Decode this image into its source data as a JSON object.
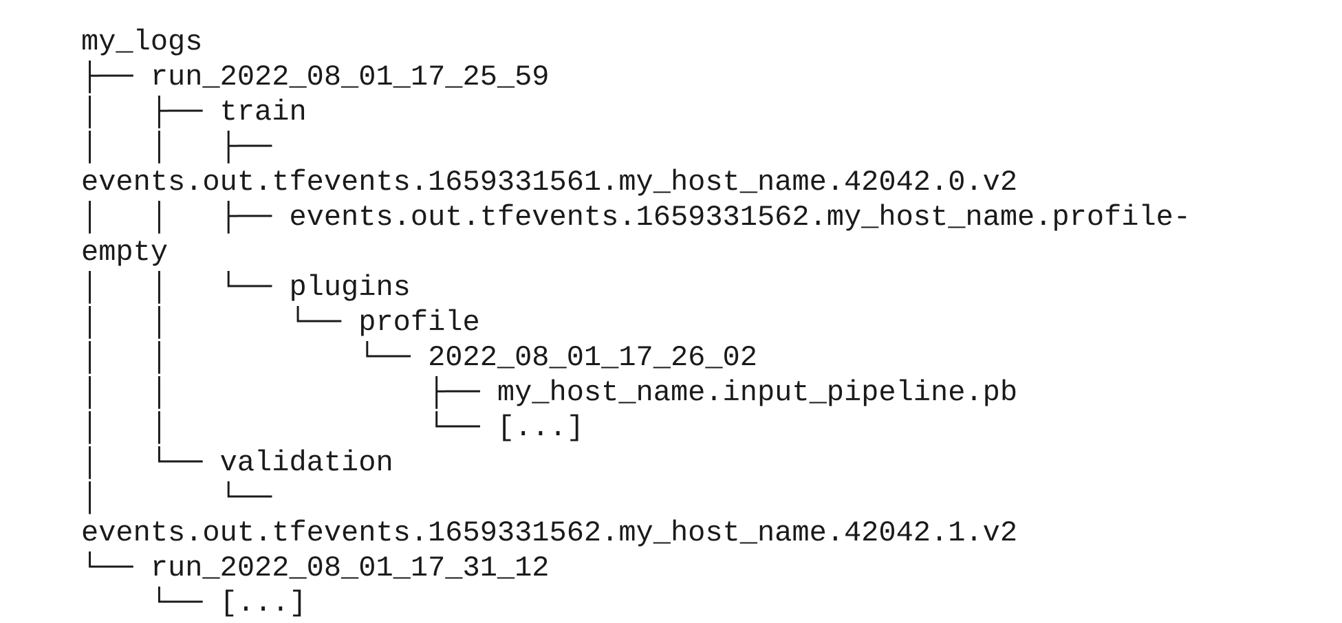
{
  "tree_lines": [
    "my_logs",
    "├── run_2022_08_01_17_25_59",
    "│   ├── train",
    "│   │   ├──",
    "events.out.tfevents.1659331561.my_host_name.42042.0.v2",
    "│   │   ├── events.out.tfevents.1659331562.my_host_name.profile-",
    "empty",
    "│   │   └── plugins",
    "│   │       └── profile",
    "│   │           └── 2022_08_01_17_26_02",
    "│   │               ├── my_host_name.input_pipeline.pb",
    "│   │               └── [...]",
    "│   └── validation",
    "│       └──",
    "events.out.tfevents.1659331562.my_host_name.42042.1.v2",
    "└── run_2022_08_01_17_31_12",
    "    └── [...]"
  ]
}
